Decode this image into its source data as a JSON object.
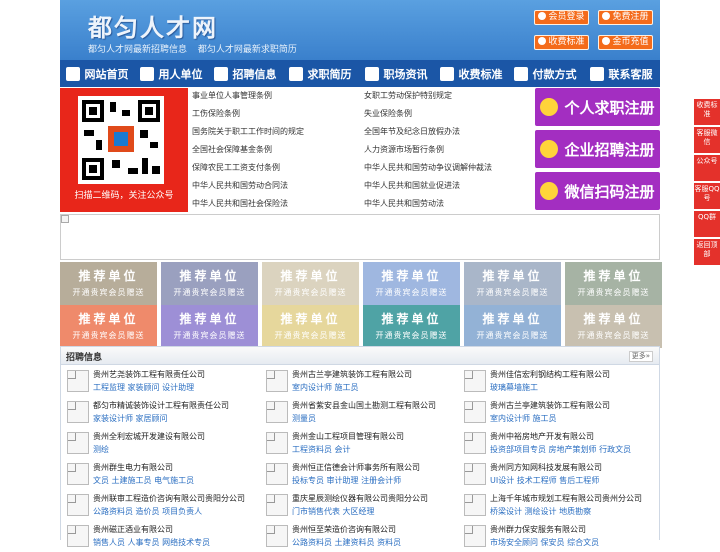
{
  "header": {
    "site_title": "都匀人才网",
    "sub_links": [
      "都匀人才网最新招聘信息",
      "都匀人才网最新求职简历"
    ],
    "buttons": [
      {
        "label": "会员登录",
        "icon": "user-icon"
      },
      {
        "label": "免费注册",
        "icon": "register-icon"
      },
      {
        "label": "收费标准",
        "icon": "price-icon"
      },
      {
        "label": "金币充值",
        "icon": "coin-icon"
      }
    ]
  },
  "nav": {
    "items": [
      {
        "label": "网站首页",
        "icon": "home-icon"
      },
      {
        "label": "用人单位",
        "icon": "building-icon"
      },
      {
        "label": "招聘信息",
        "icon": "chat-icon"
      },
      {
        "label": "求职简历",
        "icon": "resume-icon"
      },
      {
        "label": "职场资讯",
        "icon": "news-icon"
      },
      {
        "label": "收费标准",
        "icon": "money-icon"
      },
      {
        "label": "付款方式",
        "icon": "card-icon"
      },
      {
        "label": "联系客服",
        "icon": "phone-icon"
      }
    ]
  },
  "qr": {
    "caption": "扫描二维码，关注公众号"
  },
  "links": {
    "left": [
      "事业单位人事管理条例",
      "工伤保险条例",
      "国务院关于职工工作时间的规定",
      "全国社会保障基金条例",
      "保障农民工工资支付条例",
      "中华人民共和国劳动合同法",
      "中华人民共和国社会保险法"
    ],
    "right": [
      "女职工劳动保护特别规定",
      "失业保险条例",
      "全国年节及纪念日放假办法",
      "人力资源市场暂行条例",
      "中华人民共和国劳动争议调解仲裁法",
      "中华人民共和国就业促进法",
      "中华人民共和国劳动法"
    ]
  },
  "register": [
    "个人求职注册",
    "企业招聘注册",
    "微信扫码注册"
  ],
  "recommend": {
    "title": "推荐单位",
    "subtitle": "开通贵宾会员赠送",
    "colors": [
      "#b7ad9a",
      "#9aa0bf",
      "#dbd3bf",
      "#9fb7e0",
      "#a9b6c9",
      "#a6b3a4",
      "#ef8a6b",
      "#9d8fd6",
      "#e6d79c",
      "#4fa3a5",
      "#93b2d6",
      "#c8c0b0"
    ]
  },
  "jobs": {
    "section_title": "招聘信息",
    "more_label": "更多»",
    "columns": [
      [
        {
          "company": "贵州艺尧装饰工程有限责任公司",
          "positions": "工程监理 家装顾问 设计助理"
        },
        {
          "company": "都匀市精诚装饰设计工程有限责任公司",
          "positions": "家装设计师 家居顾问"
        },
        {
          "company": "贵州全利宏城开发建设有限公司",
          "positions": "测绘"
        },
        {
          "company": "贵州群生电力有限公司",
          "positions": "文员 土建施工员 电气施工员"
        },
        {
          "company": "贵州联审工程造价咨询有限公司贵阳分公司",
          "positions": "公路资料员 造价员 项目负责人"
        },
        {
          "company": "贵州磁正酒业有限公司",
          "positions": "销售人员 人事专员 网络技术专员"
        }
      ],
      [
        {
          "company": "贵州古兰亭建筑装饰工程有限公司",
          "positions": "室内设计师 施工员"
        },
        {
          "company": "贵州省紫安县金山国土勘测工程有限公司",
          "positions": "测量员"
        },
        {
          "company": "贵州金山工程项目管理有限公司",
          "positions": "工程资料员 会计"
        },
        {
          "company": "贵州恒正信德会计师事务所有限公司",
          "positions": "投标专员 审计助理 注册会计师"
        },
        {
          "company": "重庆星辰测绘仪器有限公司贵阳分公司",
          "positions": "门市销售代表 大区经理"
        },
        {
          "company": "贵州恒至荣造价咨询有限公司",
          "positions": "公路资料员 土建资料员 资料员"
        }
      ],
      [
        {
          "company": "贵州佳信宏利钢结构工程有限公司",
          "positions": "玻璃幕墙施工"
        },
        {
          "company": "贵州古兰亭建筑装饰工程有限公司",
          "positions": "室内设计师 施工员"
        },
        {
          "company": "贵州中裕房地产开发有限公司",
          "positions": "投资部项目专员 房地产策划师 行政文员"
        },
        {
          "company": "贵州同方知网科技发展有限公司",
          "positions": "UI设计 技术工程师 售后工程师"
        },
        {
          "company": "上海千年城市规划工程有限公司贵州分公司",
          "positions": "桥梁设计 测绘设计 地质勘察"
        },
        {
          "company": "贵州群力保安服务有限公司",
          "positions": "市场安全顾问 保安员 综合文员"
        }
      ]
    ]
  },
  "side_bar": [
    "收费标准",
    "客服微信",
    "公众号",
    "客服QQ号",
    "QQ群",
    "返回顶部"
  ]
}
